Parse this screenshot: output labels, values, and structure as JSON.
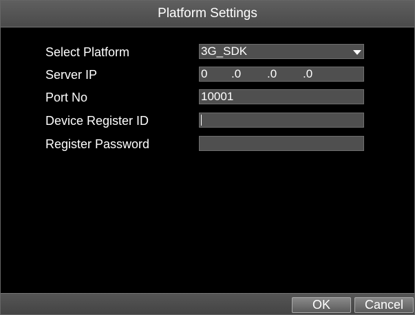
{
  "dialog": {
    "title": "Platform Settings"
  },
  "form": {
    "select_platform": {
      "label": "Select Platform",
      "value": "3G_SDK"
    },
    "server_ip": {
      "label": "Server IP",
      "octets": [
        "0",
        ".0",
        ".0",
        ".0"
      ]
    },
    "port_no": {
      "label": "Port No",
      "value": "10001"
    },
    "device_register_id": {
      "label": "Device Register ID",
      "value": ""
    },
    "register_password": {
      "label": "Register Password",
      "value": ""
    }
  },
  "footer": {
    "ok_label": "OK",
    "cancel_label": "Cancel"
  }
}
